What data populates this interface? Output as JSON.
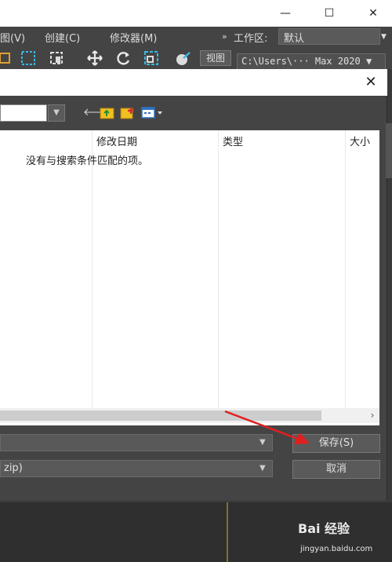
{
  "window": {
    "minimize": "—",
    "maximize": "☐",
    "close": "✕"
  },
  "menubar": {
    "items": [
      "图(V)",
      "创建(C)",
      "修改器(M)"
    ],
    "overflow": "»",
    "workspace_label": "工作区:",
    "workspace_value": "默认",
    "workspace_arrow": "▼"
  },
  "toolbar": {
    "view_label": "视图",
    "path_value": "C:\\Users\\··· Max 2020 ▼"
  },
  "dialog": {
    "close": "✕",
    "columns": [
      "修改日期",
      "类型",
      "大小"
    ],
    "empty_message": "没有与搜索条件匹配的项。",
    "filename_value": "",
    "filetype_value": "zip)",
    "save_label": "保存(S)",
    "cancel_label": "取消",
    "scroll_right": "›"
  },
  "watermark": {
    "brand": "Bai 经验",
    "site": "jingyan.baidu.com"
  },
  "colors": {
    "annotation_arrow": "#e02020",
    "accent_line": "#8a6d2d"
  }
}
